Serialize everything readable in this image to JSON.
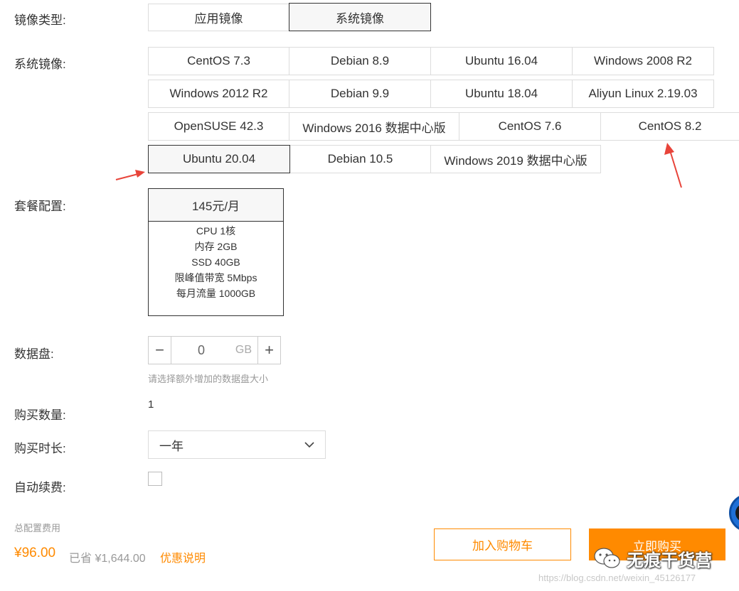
{
  "image_type": {
    "label": "镜像类型:",
    "options": [
      "应用镜像",
      "系统镜像"
    ],
    "selected": "系统镜像"
  },
  "system_image": {
    "label": "系统镜像:",
    "rows": [
      [
        "CentOS 7.3",
        "Debian 8.9",
        "Ubuntu 16.04",
        "Windows 2008 R2"
      ],
      [
        "Windows 2012 R2",
        "Debian 9.9",
        "Ubuntu 18.04",
        "Aliyun Linux 2.19.03"
      ],
      [
        "OpenSUSE 42.3",
        "Windows 2016 数据中心版",
        "CentOS 7.6",
        "CentOS 8.2"
      ],
      [
        "Ubuntu 20.04",
        "Debian 10.5",
        "Windows 2019 数据中心版"
      ]
    ],
    "selected": "Ubuntu 20.04"
  },
  "plan": {
    "label": "套餐配置:",
    "price": "145元/月",
    "specs": [
      "CPU 1核",
      "内存 2GB",
      "SSD 40GB",
      "限峰值带宽 5Mbps",
      "每月流量 1000GB"
    ]
  },
  "data_disk": {
    "label": "数据盘:",
    "value": "0",
    "unit": "GB",
    "minus": "−",
    "plus": "+",
    "hint": "请选择额外增加的数据盘大小"
  },
  "quantity": {
    "label": "购买数量:",
    "value": "1"
  },
  "duration": {
    "label": "购买时长:",
    "value": "一年"
  },
  "auto_renew": {
    "label": "自动续费:",
    "checked": false
  },
  "summary": {
    "total_label": "总配置费用",
    "price": "¥96.00",
    "saved": "已省 ¥1,644.00",
    "promo_link": "优惠说明",
    "add_to_cart": "加入购物车",
    "buy_now": "立即购买"
  },
  "watermark": {
    "text": "无痕干货营",
    "url": "https://blog.csdn.net/weixin_45126177"
  },
  "colors": {
    "accent": "#ff8a00",
    "selected_border": "#333333",
    "border": "#dcdcdc",
    "arrow": "#e8443a"
  }
}
